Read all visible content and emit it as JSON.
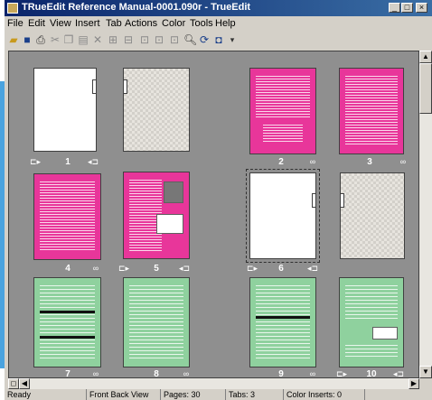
{
  "window": {
    "title": "TRueEdit Reference Manual-0001.090r - TrueEdit",
    "buttons": [
      "_",
      "□",
      "×"
    ]
  },
  "menu": [
    "File",
    "Edit",
    "View",
    "Insert",
    "Tab",
    "Actions",
    "Color",
    "Tools",
    "Help"
  ],
  "toolbar": {
    "icons": [
      "open-icon",
      "save-icon",
      "print-icon",
      "cut-icon",
      "copy-icon",
      "paste-icon",
      "delete-icon",
      "insert-page-icon",
      "insert-tab-icon",
      "tab-a-icon",
      "tab-b-icon",
      "tab-c-icon",
      "zoom-icon",
      "refresh-icon",
      "view-icon",
      "dropdown-icon"
    ]
  },
  "pages": [
    {
      "num": "1",
      "kind": "white",
      "tab": true
    },
    {
      "num": "",
      "kind": "check",
      "tab": true
    },
    {
      "num": "2",
      "kind": "magenta"
    },
    {
      "num": "3",
      "kind": "magenta"
    },
    {
      "num": "4",
      "kind": "magenta"
    },
    {
      "num": "5",
      "kind": "magenta"
    },
    {
      "num": "6",
      "kind": "white",
      "tab": true
    },
    {
      "num": "",
      "kind": "check",
      "tab": true
    },
    {
      "num": "7",
      "kind": "green"
    },
    {
      "num": "8",
      "kind": "green"
    },
    {
      "num": "9",
      "kind": "green"
    },
    {
      "num": "10",
      "kind": "green"
    }
  ],
  "status": {
    "ready": "Ready",
    "view": "Front Back View",
    "pages": "Pages: 30",
    "tabs": "Tabs: 3",
    "inserts": "Color Inserts: 0"
  }
}
